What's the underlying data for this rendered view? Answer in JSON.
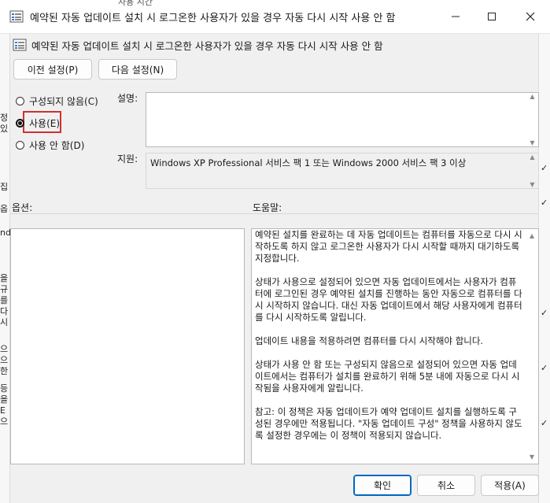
{
  "window": {
    "title": "예약된 자동 업데이트 설치 시 로그온한 사용자가 있을 경우 자동 다시 시작 사용 안 함",
    "minimize_icon": "minimize-icon",
    "maximize_icon": "maximize-icon",
    "close_icon": "close-icon"
  },
  "header": {
    "policy_name": "예약된 자동 업데이트 설치 시 로그온한 사용자가 있을 경우 자동 다시 시작 사용 안 함"
  },
  "nav": {
    "prev_label": "이전 설정(P)",
    "next_label": "다음 설정(N)"
  },
  "state": {
    "options": [
      {
        "label": "구성되지 않음(C)",
        "checked": false
      },
      {
        "label": "사용(E)",
        "checked": true
      },
      {
        "label": "사용 안 함(D)",
        "checked": false
      }
    ],
    "highlight_color": "#d32f2f"
  },
  "comment": {
    "label": "설명:",
    "value": ""
  },
  "supported": {
    "label": "지원:",
    "value": "Windows XP Professional 서비스 팩 1 또는 Windows 2000 서비스 팩 3 이상"
  },
  "options_panel": {
    "label": "옵션:"
  },
  "help_panel": {
    "label": "도움말:",
    "paragraphs": [
      "예약된 설치를 완료하는 데 자동 업데이트는 컴퓨터를 자동으로 다시 시작하도록 하지 않고 로그온한 사용자가 다시 시작할 때까지 대기하도록 지정합니다.",
      "상태가 사용으로 설정되어 있으면 자동 업데이트에서는 사용자가 컴퓨터에 로그인된 경우 예약된 설치를 진행하는 동안 자동으로 컴퓨터를 다시 시작하지 않습니다. 대신 자동 업데이트에서 해당 사용자에게 컴퓨터를 다시 시작하도록 알립니다.",
      "업데이트 내용을 적용하려면 컴퓨터를 다시 시작해야 합니다.",
      "상태가 사용 안 함 또는 구성되지 않음으로 설정되어 있으면 자동 업데이트에서는 컴퓨터가 설치를 완료하기 위해 5분 내에 자동으로 다시 시작됨을 사용자에게 알립니다.",
      "참고: 이 정책은 자동 업데이트가 예약 업데이트 설치를 실행하도록 구성된 경우에만 적용됩니다. \"자동 업데이트 구성\" 정책을 사용하지 않도록 설정한 경우에는 이 정책이 적용되지 않습니다."
    ]
  },
  "footer": {
    "ok_label": "확인",
    "cancel_label": "취소",
    "apply_label": "적용(A)"
  },
  "background": {
    "top_text": "사용 시간",
    "left_chars": [
      "정",
      "있",
      "집",
      "옵",
      "nd",
      "을",
      "규",
      "를",
      "다",
      "시",
      "으",
      "으",
      "한",
      "등",
      "을",
      "E",
      "으"
    ],
    "right_chars": [
      "✓",
      "✓",
      "✓",
      "✓",
      "✓"
    ]
  }
}
